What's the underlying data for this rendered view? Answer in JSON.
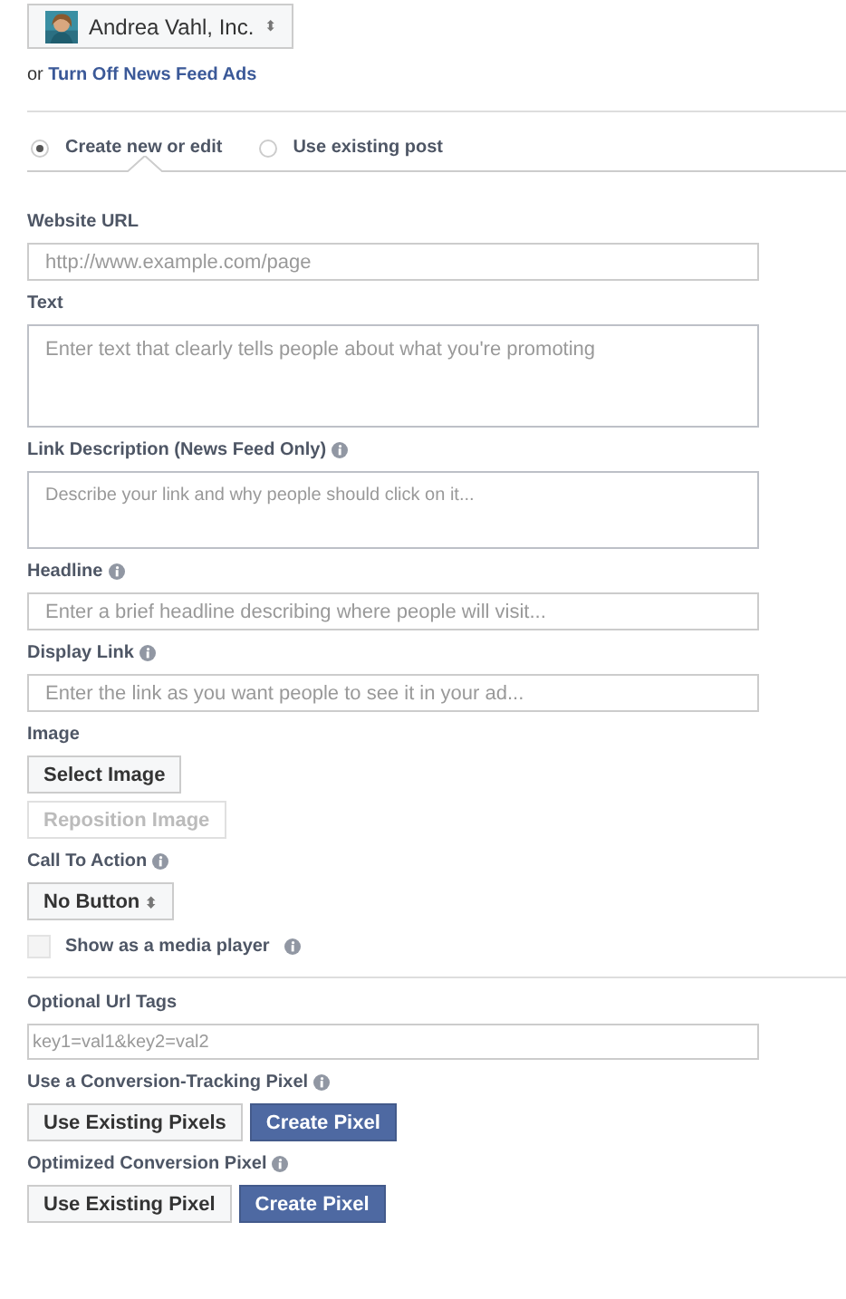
{
  "account": {
    "name": "Andrea Vahl, Inc.",
    "caret": "⬍"
  },
  "opt_out": {
    "prefix": "or",
    "link": "Turn Off News Feed Ads"
  },
  "post_options": [
    {
      "label": "Create new or edit",
      "selected": true
    },
    {
      "label": "Use existing post",
      "selected": false
    }
  ],
  "form_sections": [
    {
      "items": [
        {
          "kind": "text_input",
          "label": "Website URL",
          "info": false,
          "placeholder": "http://www.example.com/page"
        },
        {
          "kind": "textarea",
          "label": "Text",
          "info": false,
          "placeholder": "Enter text that clearly tells people about what you're promoting"
        },
        {
          "kind": "textarea",
          "label": "Link Description (News Feed Only)",
          "info": true,
          "placeholder": "Describe your link and why people should click on it..."
        },
        {
          "kind": "text_input",
          "label": "Headline",
          "info": true,
          "placeholder": "Enter a brief headline describing where people will visit..."
        },
        {
          "kind": "text_input",
          "label": "Display Link",
          "info": true,
          "placeholder": "Enter the link as you want people to see it in your ad..."
        },
        {
          "kind": "stacked_buttons",
          "label": "Image",
          "info": false,
          "buttons": [
            {
              "label": "Select Image",
              "disabled": false
            },
            {
              "label": "Reposition Image",
              "disabled": true
            }
          ]
        },
        {
          "kind": "select",
          "label": "Call To Action",
          "info": true,
          "value": "No Button",
          "caret": "⬍"
        },
        {
          "kind": "checkbox",
          "label": "Show as a media player",
          "info": true,
          "checked": false
        }
      ]
    },
    {
      "items": [
        {
          "kind": "small_input",
          "label": "Optional Url Tags",
          "info": false,
          "placeholder": "key1=val1&key2=val2"
        },
        {
          "kind": "pixel_buttons",
          "label": "Use a Conversion-Tracking Pixel",
          "info": true,
          "buttons": [
            "Use Existing Pixels",
            "Create Pixel"
          ]
        },
        {
          "kind": "pixel_buttons",
          "label": "Optimized Conversion Pixel",
          "info": true,
          "buttons": [
            "Use Existing Pixel",
            "Create Pixel"
          ]
        }
      ]
    }
  ]
}
